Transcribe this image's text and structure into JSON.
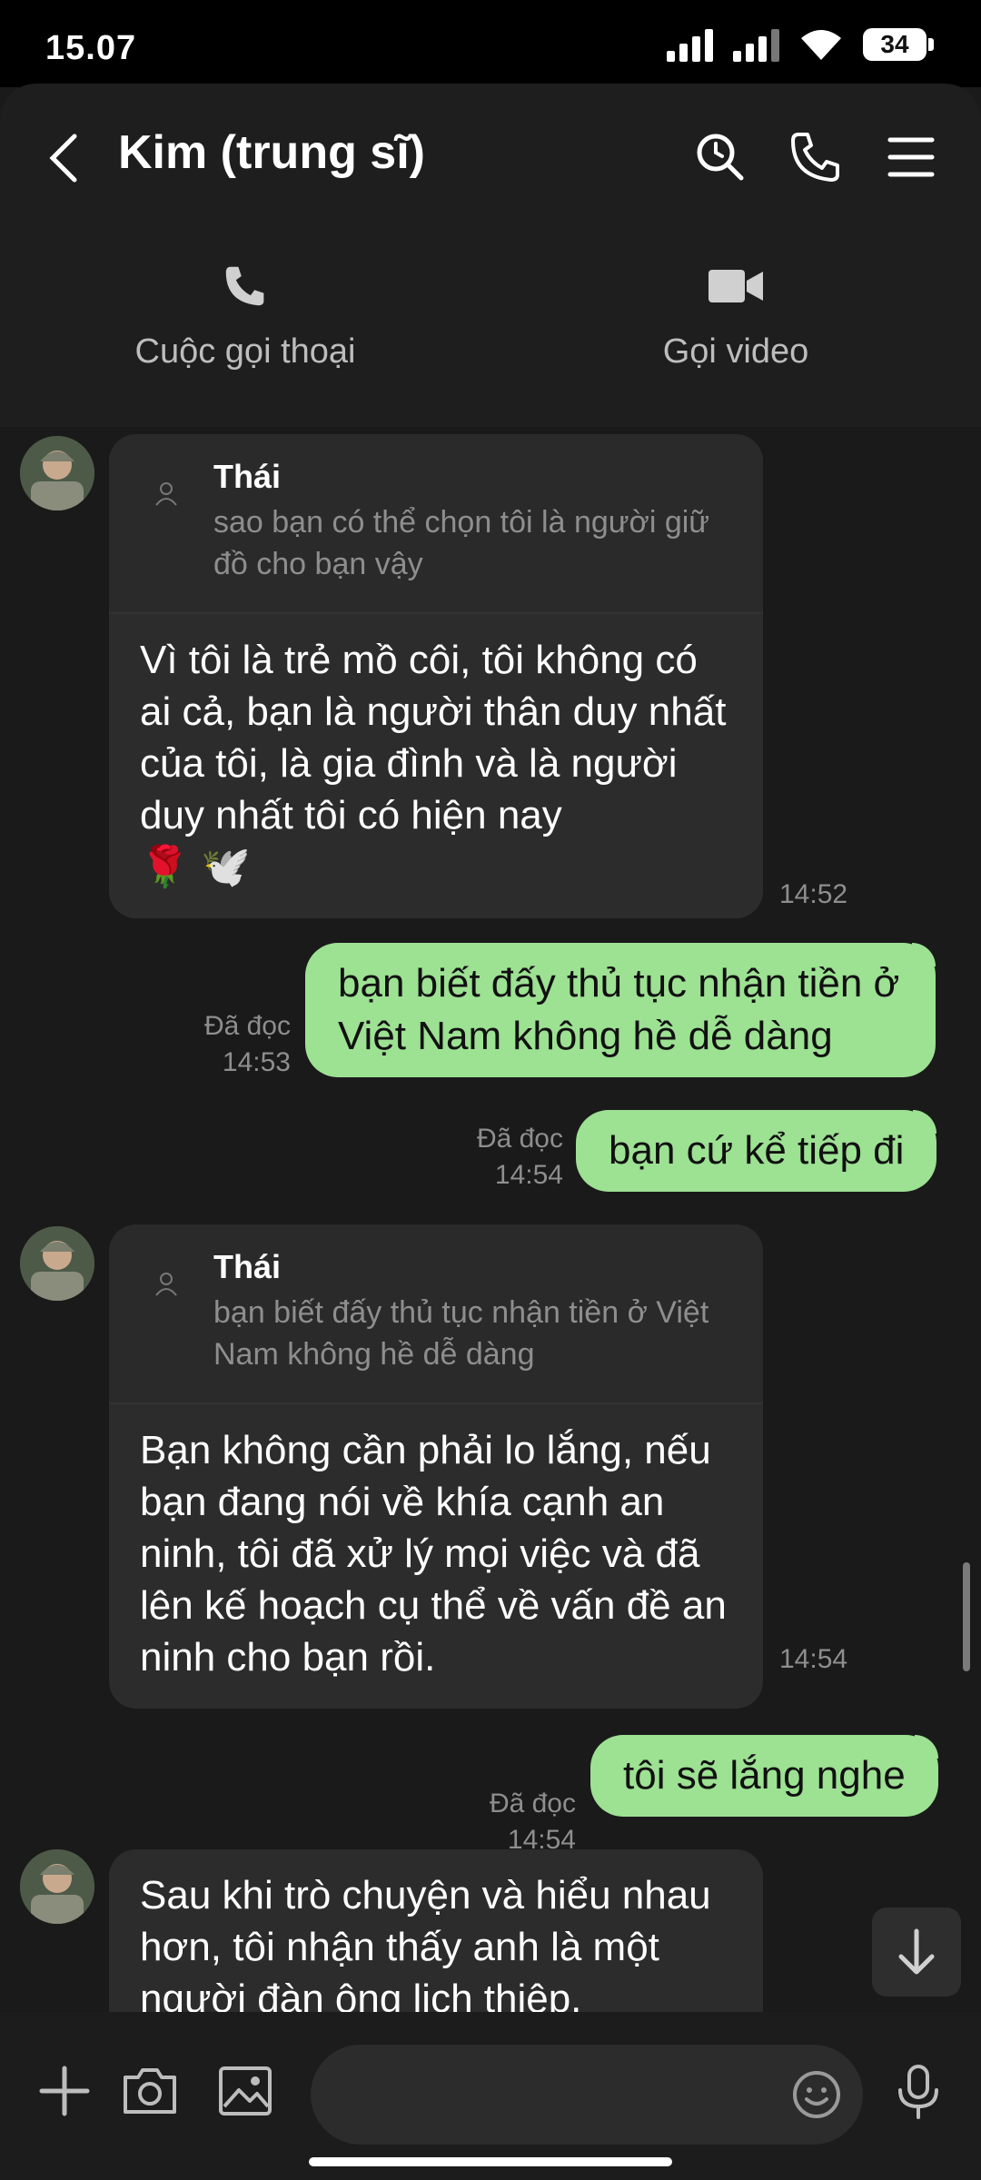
{
  "status": {
    "time": "15.07",
    "battery": "34"
  },
  "header": {
    "title": "Kim (trung sĩ)",
    "voice_call_label": "Cuộc gọi thoại",
    "video_call_label": "Gọi video"
  },
  "messages": [
    {
      "type": "in",
      "reply_name": "Thái",
      "reply_text": "sao bạn có thể chọn tôi là người giữ đồ cho bạn vậy",
      "text": "Vì tôi là trẻ mồ côi, tôi không có ai cả, bạn là người thân duy nhất của tôi, là gia đình và là người duy nhất tôi có hiện nay",
      "emoji": "🌹 🕊️",
      "time": "14:52"
    },
    {
      "type": "out",
      "text": "bạn biết đấy thủ tục nhận tiền ở Việt Nam không hề dễ dàng",
      "read": "Đã đọc",
      "time": "14:53"
    },
    {
      "type": "out",
      "text": "bạn cứ kể tiếp đi",
      "read": "Đã đọc",
      "time": "14:54"
    },
    {
      "type": "in",
      "reply_name": "Thái",
      "reply_text": "bạn biết đấy thủ tục nhận tiền ở Việt Nam không hề dễ dàng",
      "text": "Bạn không cần phải lo lắng, nếu bạn đang nói về khía cạnh an ninh, tôi đã xử lý mọi việc và đã lên kế hoạch cụ thể về vấn đề an ninh cho bạn rồi.",
      "time": "14:54"
    },
    {
      "type": "out",
      "text": "tôi sẽ lắng nghe",
      "read": "Đã đọc",
      "time": "14:54"
    },
    {
      "type": "in",
      "text": "Sau khi trò chuyện và hiểu nhau hơn, tôi nhận thấy anh là một người đàn ông lịch thiệp."
    }
  ],
  "composer": {
    "placeholder": ""
  },
  "icons": [
    "back-icon",
    "search-icon",
    "phone-icon",
    "menu-icon",
    "add-icon",
    "camera-icon",
    "image-icon",
    "emoji-icon",
    "mic-icon",
    "arrow-down-icon"
  ]
}
